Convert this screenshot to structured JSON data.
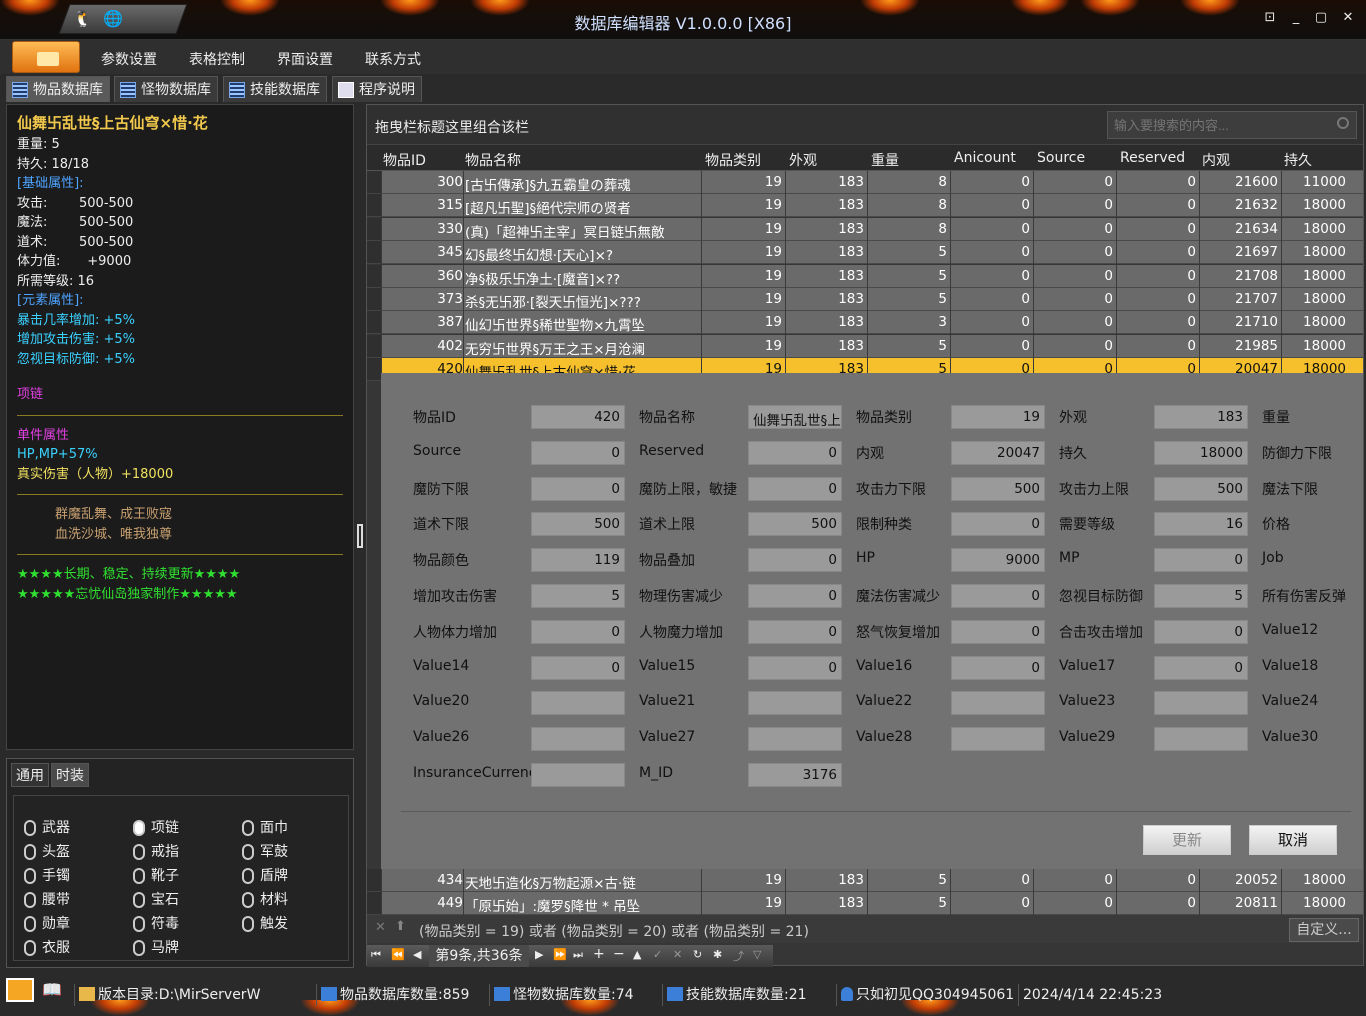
{
  "window": {
    "title": "数据库编辑器 V1.0.0.0 [X86]"
  },
  "menu": [
    "参数设置",
    "表格控制",
    "界面设置",
    "联系方式"
  ],
  "db_tabs": [
    "物品数据库",
    "怪物数据库",
    "技能数据库",
    "程序说明"
  ],
  "tooltip": {
    "name": "仙舞卐乱世§上古仙穹×惜·花",
    "weight": "重量: 5",
    "durability": "持久: 18/18",
    "basic_header": "[基础属性]:",
    "attrs": [
      {
        "k": "攻击:",
        "v": "500-500"
      },
      {
        "k": "魔法:",
        "v": "500-500"
      },
      {
        "k": "道术:",
        "v": "500-500"
      },
      {
        "k": "体力值:",
        "v": "  +9000"
      }
    ],
    "req_level": "所需等级: 16",
    "element_header": "[元素属性]:",
    "elements": [
      "暴击几率增加: +5%",
      "增加攻击伤害: +5%",
      "忽视目标防御: +5%"
    ],
    "category": "项链",
    "single_header": "单件属性",
    "single_1": "HP,MP+57%",
    "single_2": "真实伤害（人物）+18000",
    "flavor_1": "群魔乱舞、成王败寇",
    "flavor_2": "血洗沙城、唯我独尊",
    "slogan_1": "★★★★长期、稳定、持续更新★★★★",
    "slogan_2": "★★★★★忘忧仙岛独家制作★★★★★"
  },
  "sub_tabs": [
    "通用",
    "时装"
  ],
  "slots": [
    {
      "label": "武器",
      "on": false
    },
    {
      "label": "项链",
      "on": true
    },
    {
      "label": "面巾",
      "on": false
    },
    {
      "label": "头盔",
      "on": false
    },
    {
      "label": "戒指",
      "on": false
    },
    {
      "label": "军鼓",
      "on": false
    },
    {
      "label": "手镯",
      "on": false
    },
    {
      "label": "靴子",
      "on": false
    },
    {
      "label": "盾牌",
      "on": false
    },
    {
      "label": "腰带",
      "on": false
    },
    {
      "label": "宝石",
      "on": false
    },
    {
      "label": "材料",
      "on": false
    },
    {
      "label": "勋章",
      "on": false
    },
    {
      "label": "符毒",
      "on": false
    },
    {
      "label": "触发",
      "on": false
    },
    {
      "label": "衣服",
      "on": false
    },
    {
      "label": "马牌",
      "on": false
    }
  ],
  "group_hint": "拖曳栏标题这里组合该栏",
  "search_placeholder": "输入要搜索的内容...",
  "columns": [
    "物品ID",
    "物品名称",
    "物品类别",
    "外观",
    "重量",
    "Anicount",
    "Source",
    "Reserved",
    "内观",
    "持久"
  ],
  "rows": [
    [
      "300",
      "[古卐傳承]§九五霸皇の葬魂",
      "19",
      "183",
      "8",
      "0",
      "0",
      "0",
      "21600",
      "11000"
    ],
    [
      "315",
      "[超凡卐聖]§絕代宗师の贤者",
      "19",
      "183",
      "8",
      "0",
      "0",
      "0",
      "21632",
      "18000"
    ],
    [
      "330",
      "(真)「超神卐主宰」冥日链卐無敵",
      "19",
      "183",
      "8",
      "0",
      "0",
      "0",
      "21634",
      "18000"
    ],
    [
      "345",
      "幻§最终卐幻想·[天心]×?",
      "19",
      "183",
      "5",
      "0",
      "0",
      "0",
      "21697",
      "18000"
    ],
    [
      "360",
      "净§极乐卐净土·[魔音]×??",
      "19",
      "183",
      "5",
      "0",
      "0",
      "0",
      "21708",
      "18000"
    ],
    [
      "373",
      "杀§无卐邪·[裂天卐恒光]×???",
      "19",
      "183",
      "5",
      "0",
      "0",
      "0",
      "21707",
      "18000"
    ],
    [
      "387",
      "仙幻卐世界§稀世聖物×九霄坠",
      "19",
      "183",
      "3",
      "0",
      "0",
      "0",
      "21710",
      "18000"
    ],
    [
      "402",
      "无穷卐世界§万王之王×月沧澜",
      "19",
      "183",
      "5",
      "0",
      "0",
      "0",
      "21985",
      "18000"
    ],
    [
      "420",
      "仙舞卐乱世§上古仙穹×惜·花",
      "19",
      "183",
      "5",
      "0",
      "0",
      "0",
      "20047",
      "18000"
    ]
  ],
  "rows_after": [
    [
      "434",
      "天地卐造化§万物起源×古·链",
      "19",
      "183",
      "5",
      "0",
      "0",
      "0",
      "20052",
      "18000"
    ],
    [
      "449",
      "「原卐始」:魔罗§降世 * 吊坠",
      "19",
      "183",
      "5",
      "0",
      "0",
      "0",
      "20811",
      "18000"
    ]
  ],
  "fields": [
    {
      "l": "物品ID",
      "v": "420"
    },
    {
      "l": "物品名称",
      "v": "仙舞卐乱世§上"
    },
    {
      "l": "物品类别",
      "v": "19"
    },
    {
      "l": "外观",
      "v": "183"
    },
    {
      "l": "重量",
      "v": ""
    },
    {
      "l": "Source",
      "v": "0"
    },
    {
      "l": "Reserved",
      "v": "0"
    },
    {
      "l": "内观",
      "v": "20047"
    },
    {
      "l": "持久",
      "v": "18000"
    },
    {
      "l": "防御力下限",
      "v": ""
    },
    {
      "l": "魔防下限",
      "v": "0"
    },
    {
      "l": "魔防上限，敏捷",
      "v": "0"
    },
    {
      "l": "攻击力下限",
      "v": "500"
    },
    {
      "l": "攻击力上限",
      "v": "500"
    },
    {
      "l": "魔法下限",
      "v": ""
    },
    {
      "l": "道术下限",
      "v": "500"
    },
    {
      "l": "道术上限",
      "v": "500"
    },
    {
      "l": "限制种类",
      "v": "0"
    },
    {
      "l": "需要等级",
      "v": "16"
    },
    {
      "l": "价格",
      "v": ""
    },
    {
      "l": "物品颜色",
      "v": "119"
    },
    {
      "l": "物品叠加",
      "v": "0"
    },
    {
      "l": "HP",
      "v": "9000"
    },
    {
      "l": "MP",
      "v": "0"
    },
    {
      "l": "Job",
      "v": ""
    },
    {
      "l": "增加攻击伤害",
      "v": "5"
    },
    {
      "l": "物理伤害减少",
      "v": "0"
    },
    {
      "l": "魔法伤害减少",
      "v": "0"
    },
    {
      "l": "忽视目标防御",
      "v": "5"
    },
    {
      "l": "所有伤害反弹",
      "v": ""
    },
    {
      "l": "人物体力增加",
      "v": "0"
    },
    {
      "l": "人物魔力增加",
      "v": "0"
    },
    {
      "l": "怒气恢复增加",
      "v": "0"
    },
    {
      "l": "合击攻击增加",
      "v": "0"
    },
    {
      "l": "Value12",
      "v": ""
    },
    {
      "l": "Value14",
      "v": "0"
    },
    {
      "l": "Value15",
      "v": "0"
    },
    {
      "l": "Value16",
      "v": "0"
    },
    {
      "l": "Value17",
      "v": "0"
    },
    {
      "l": "Value18",
      "v": ""
    },
    {
      "l": "Value20",
      "v": ""
    },
    {
      "l": "Value21",
      "v": ""
    },
    {
      "l": "Value22",
      "v": ""
    },
    {
      "l": "Value23",
      "v": ""
    },
    {
      "l": "Value24",
      "v": ""
    },
    {
      "l": "Value26",
      "v": ""
    },
    {
      "l": "Value27",
      "v": ""
    },
    {
      "l": "Value28",
      "v": ""
    },
    {
      "l": "Value29",
      "v": ""
    },
    {
      "l": "Value30",
      "v": ""
    },
    {
      "l": "InsuranceCurrency",
      "v": ""
    },
    {
      "l": "M_ID",
      "v": "3176"
    }
  ],
  "buttons": {
    "update": "更新",
    "cancel": "取消",
    "customize": "自定义..."
  },
  "filter": "(物品类别 = 19) 或者 (物品类别 = 20) 或者 (物品类别 = 21)",
  "nav_position": "第9条,共36条",
  "status": {
    "version_dir": "版本目录:D:\\MirServerW",
    "item_count": "物品数据库数量:859",
    "monster_count": "怪物数据库数量:74",
    "skill_count": "技能数据库数量:21",
    "user": "只如初见QQ304945061",
    "datetime": "2024/4/14 22:45:23"
  }
}
